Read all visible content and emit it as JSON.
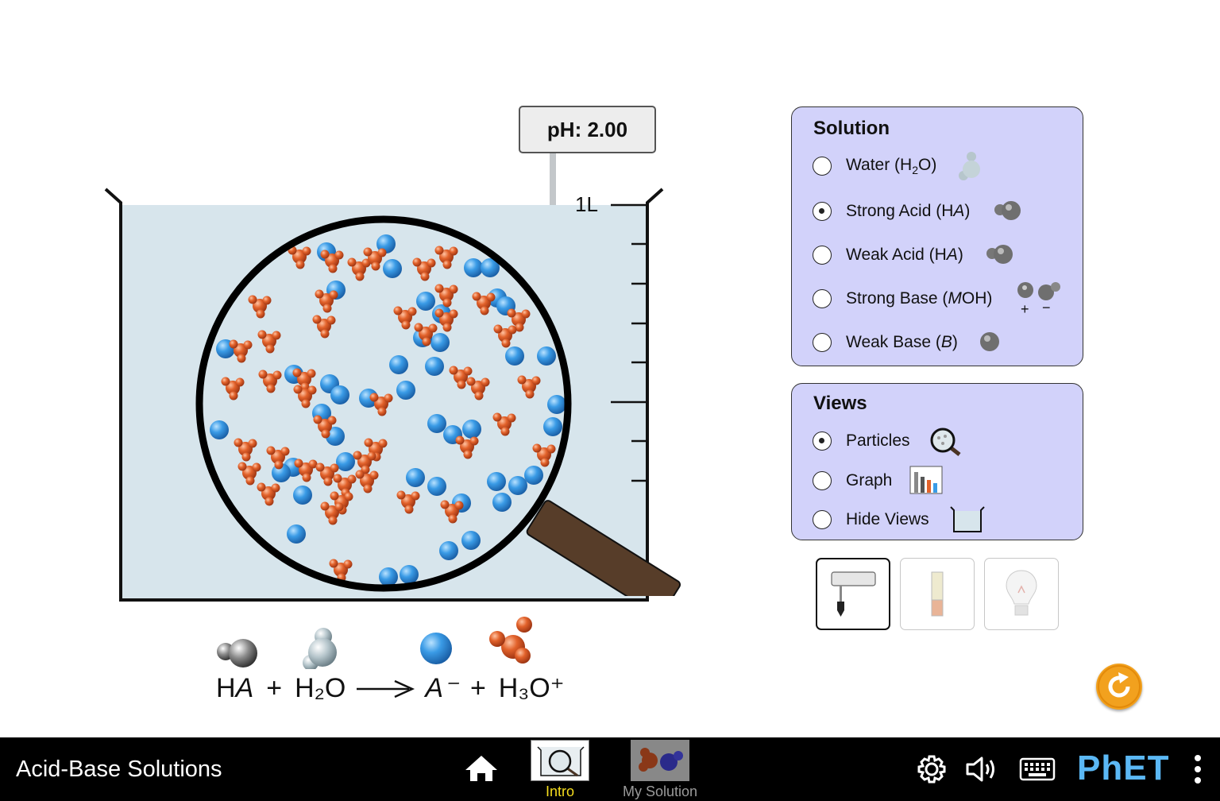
{
  "app": {
    "title": "Acid-Base Solutions"
  },
  "ph_meter": {
    "reading": "pH: 2.00"
  },
  "beaker": {
    "volume_label": "1L"
  },
  "equation": {
    "reactant1": "HA",
    "plus1": "+",
    "reactant2": "H₂O",
    "product1": "A⁻",
    "plus2": "+",
    "product2": "H₃O⁺"
  },
  "solution_panel": {
    "title": "Solution",
    "options": [
      {
        "label_pre": "Water (H",
        "label_sub": "2",
        "label_post": "O)",
        "selected": false,
        "icon": "water-molecule-icon"
      },
      {
        "label_pre": "Strong Acid (H",
        "label_it": "A",
        "label_post": ")",
        "selected": true,
        "icon": "acid-molecule-icon"
      },
      {
        "label_pre": "Weak Acid (H",
        "label_it": "A",
        "label_post": ")",
        "selected": false,
        "icon": "acid-molecule-icon"
      },
      {
        "label_pre": "Strong Base (",
        "label_it": "M",
        "label_post": "OH)",
        "selected": false,
        "icon": "base-ions-icon"
      },
      {
        "label_pre": "Weak Base (",
        "label_it": "B",
        "label_post": ")",
        "selected": false,
        "icon": "weak-base-molecule-icon"
      }
    ],
    "ion_signs": {
      "plus": "+",
      "minus": "−"
    }
  },
  "views_panel": {
    "title": "Views",
    "options": [
      {
        "label": "Particles",
        "selected": true,
        "icon": "magnifier-icon"
      },
      {
        "label": "Graph",
        "selected": false,
        "icon": "bar-graph-icon"
      },
      {
        "label": "Hide Views",
        "selected": false,
        "icon": "beaker-icon"
      }
    ]
  },
  "tools": [
    {
      "name": "ph-meter-tool",
      "selected": true
    },
    {
      "name": "ph-paper-tool",
      "selected": false
    },
    {
      "name": "conductivity-tool",
      "selected": false
    }
  ],
  "nav": {
    "screens": [
      {
        "label": "Intro",
        "active": true
      },
      {
        "label": "My Solution",
        "active": false
      }
    ],
    "brand": "PhET"
  },
  "colors": {
    "panel_bg": "#d2d2fa",
    "solution": "#d7e5ec",
    "h3o": "#e2622b",
    "anion": "#3a9be6",
    "active_tab": "#f5dd1e",
    "reset": "#f2a11e",
    "navbar": "#000000"
  }
}
